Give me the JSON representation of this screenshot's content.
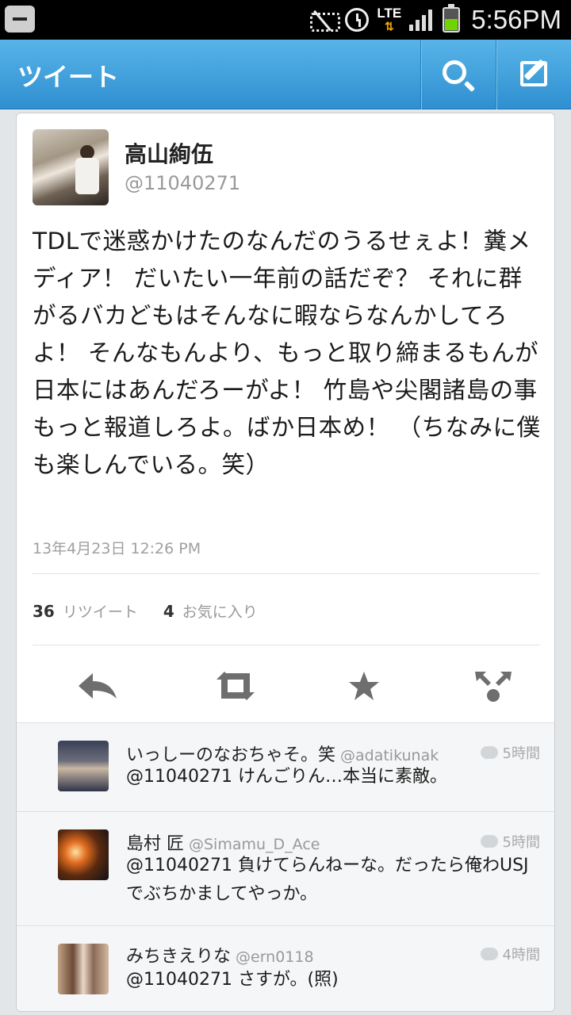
{
  "status_bar": {
    "network": "LTE",
    "time": "5:56PM"
  },
  "action_bar": {
    "title": "ツイート"
  },
  "tweet": {
    "author_name": "高山絢伍",
    "author_handle": "@11040271",
    "text": "TDLで迷惑かけたのなんだのうるせぇよ！糞メディア！ だいたい一年前の話だぞ？ それに群がるバカどもはそんなに暇ならなんかしてろよ！ そんなもんより、もっと取り締まるもんが日本にはあんだろーがよ！ 竹島や尖閣諸島の事もっと報道しろよ。ばか日本め！ （ちなみに僕も楽しんでいる。笑）",
    "timestamp": "13年4月23日 12:26 PM",
    "retweet_count": "36",
    "retweet_label": "リツイート",
    "favorite_count": "4",
    "favorite_label": "お気に入り"
  },
  "icons": {
    "reply": "reply-arrow-icon",
    "retweet": "retweet-icon",
    "favorite": "star-icon",
    "more": "share-more-icon"
  },
  "colors": {
    "action_bar": "#3a9ad9",
    "icon_gray": "#6e6e6e"
  },
  "replies": [
    {
      "name": "いっしーのなおちゃそ。笑",
      "handle": "@adatikunak",
      "time": "5時間",
      "text": "@11040271 けんごりん…本当に素敵。"
    },
    {
      "name": "島村 匠",
      "handle": "@Simamu_D_Ace",
      "time": "5時間",
      "text": "@11040271 負けてらんねーな。だったら俺わUSJでぶちかましてやっか。"
    },
    {
      "name": "みちきえりな",
      "handle": "@ern0118",
      "time": "4時間",
      "text": "@11040271 さすが。(照)"
    }
  ]
}
